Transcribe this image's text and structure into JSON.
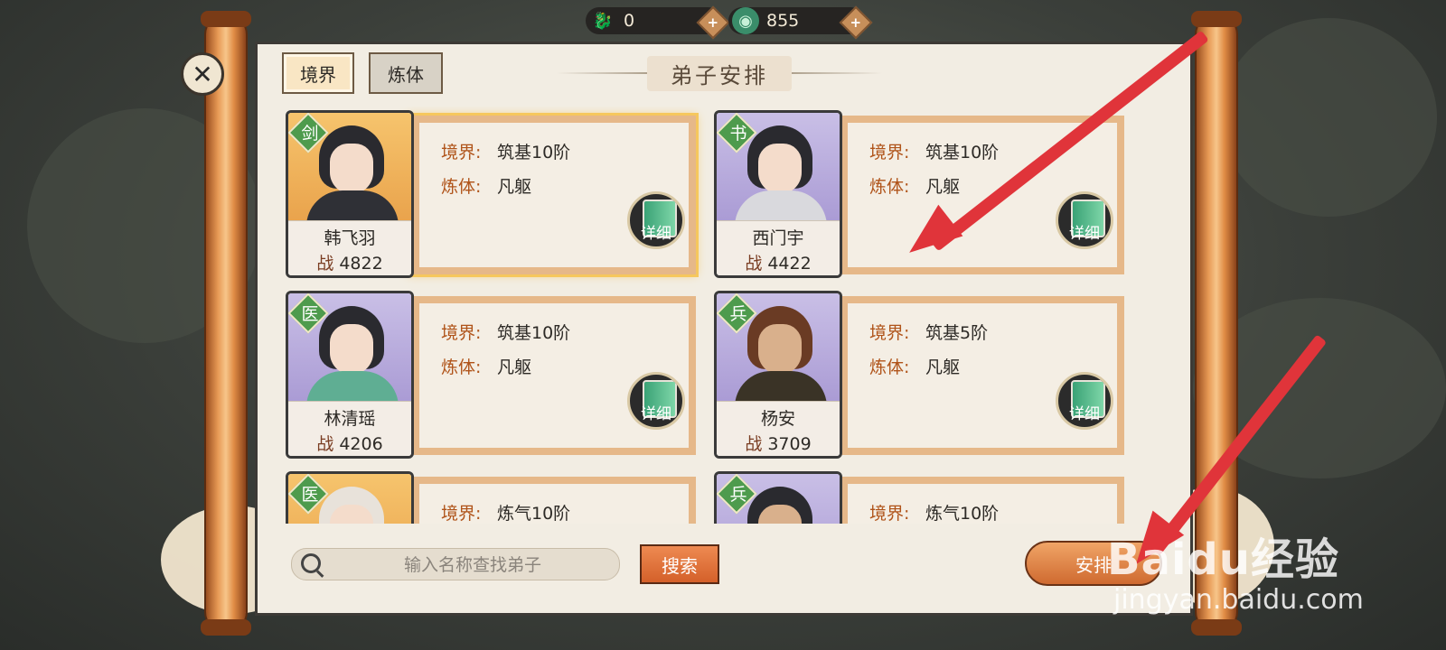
{
  "currency": [
    {
      "icon": "dragon-coin-icon",
      "value": "0"
    },
    {
      "icon": "jade-icon",
      "value": "855"
    }
  ],
  "tabs": [
    {
      "label": "境界",
      "active": true
    },
    {
      "label": "炼体",
      "active": false
    }
  ],
  "title": "弟子安排",
  "labels": {
    "realm": "境界:",
    "body": "炼体:",
    "power": "战",
    "detail": "详细"
  },
  "disciples": [
    {
      "name": "韩飞羽",
      "power": "4822",
      "badge": "剑",
      "realm": "筑基10阶",
      "body": "凡躯",
      "selected": true,
      "frame": "gold"
    },
    {
      "name": "西门宇",
      "power": "4422",
      "badge": "书",
      "realm": "筑基10阶",
      "body": "凡躯",
      "selected": false,
      "frame": "purple"
    },
    {
      "name": "林清瑶",
      "power": "4206",
      "badge": "医",
      "realm": "筑基10阶",
      "body": "凡躯",
      "selected": false,
      "frame": "purple"
    },
    {
      "name": "杨安",
      "power": "3709",
      "badge": "兵",
      "realm": "筑基5阶",
      "body": "凡躯",
      "selected": false,
      "frame": "purple"
    },
    {
      "name": "",
      "power": "",
      "badge": "医",
      "realm": "炼气10阶",
      "body": "",
      "selected": false,
      "frame": "gold"
    },
    {
      "name": "",
      "power": "",
      "badge": "兵",
      "realm": "炼气10阶",
      "body": "",
      "selected": false,
      "frame": "purple"
    }
  ],
  "search": {
    "placeholder": "输入名称查找弟子",
    "button": "搜索"
  },
  "arrange_button": "安排",
  "watermark": {
    "brand": "Baidu经验",
    "url": "jingyan.baidu.com"
  },
  "colors": {
    "accent_orange": "#d4602a",
    "badge_green": "#4e9b4d",
    "arrow_red": "#e0343a"
  }
}
